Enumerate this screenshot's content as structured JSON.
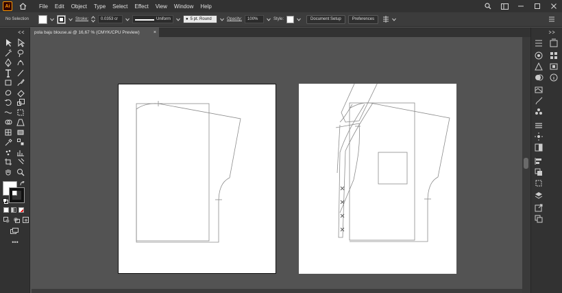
{
  "app": {
    "logo_text": "Ai"
  },
  "menu": {
    "items": [
      "File",
      "Edit",
      "Object",
      "Type",
      "Select",
      "Effect",
      "View",
      "Window",
      "Help"
    ]
  },
  "control": {
    "selection": "No Selection",
    "stroke_label": "Stroke:",
    "stroke_value": "0.0353 cr",
    "profile": "Uniform",
    "brush": "5 pt. Round",
    "opacity_label": "Opacity:",
    "opacity_value": "100%",
    "style_label": "Style:",
    "doc_setup": "Document Setup",
    "preferences": "Preferences"
  },
  "document": {
    "tab_title": "pola baju blouse.ai @ 16,67 % (CMYK/CPU Preview)",
    "close": "×"
  },
  "colors": {
    "menubar": "#323232",
    "panel": "#3c3c3c",
    "canvas": "#535353",
    "artboard": "#ffffff",
    "accent": "#ff9a00",
    "pattern_line": "#888888"
  },
  "tools": [
    "selection-tool",
    "direct-selection-tool",
    "magic-wand-tool",
    "lasso-tool",
    "pen-tool",
    "curvature-tool",
    "type-tool",
    "line-tool",
    "rectangle-tool",
    "paintbrush-tool",
    "shaper-tool",
    "eraser-tool",
    "rotate-tool",
    "scale-tool",
    "width-tool",
    "free-transform-tool",
    "shape-builder-tool",
    "perspective-tool",
    "mesh-tool",
    "gradient-tool",
    "eyedropper-tool",
    "blend-tool",
    "symbol-sprayer-tool",
    "graph-tool",
    "artboard-tool",
    "slice-tool",
    "hand-tool",
    "zoom-tool"
  ],
  "more_tools": "•••"
}
